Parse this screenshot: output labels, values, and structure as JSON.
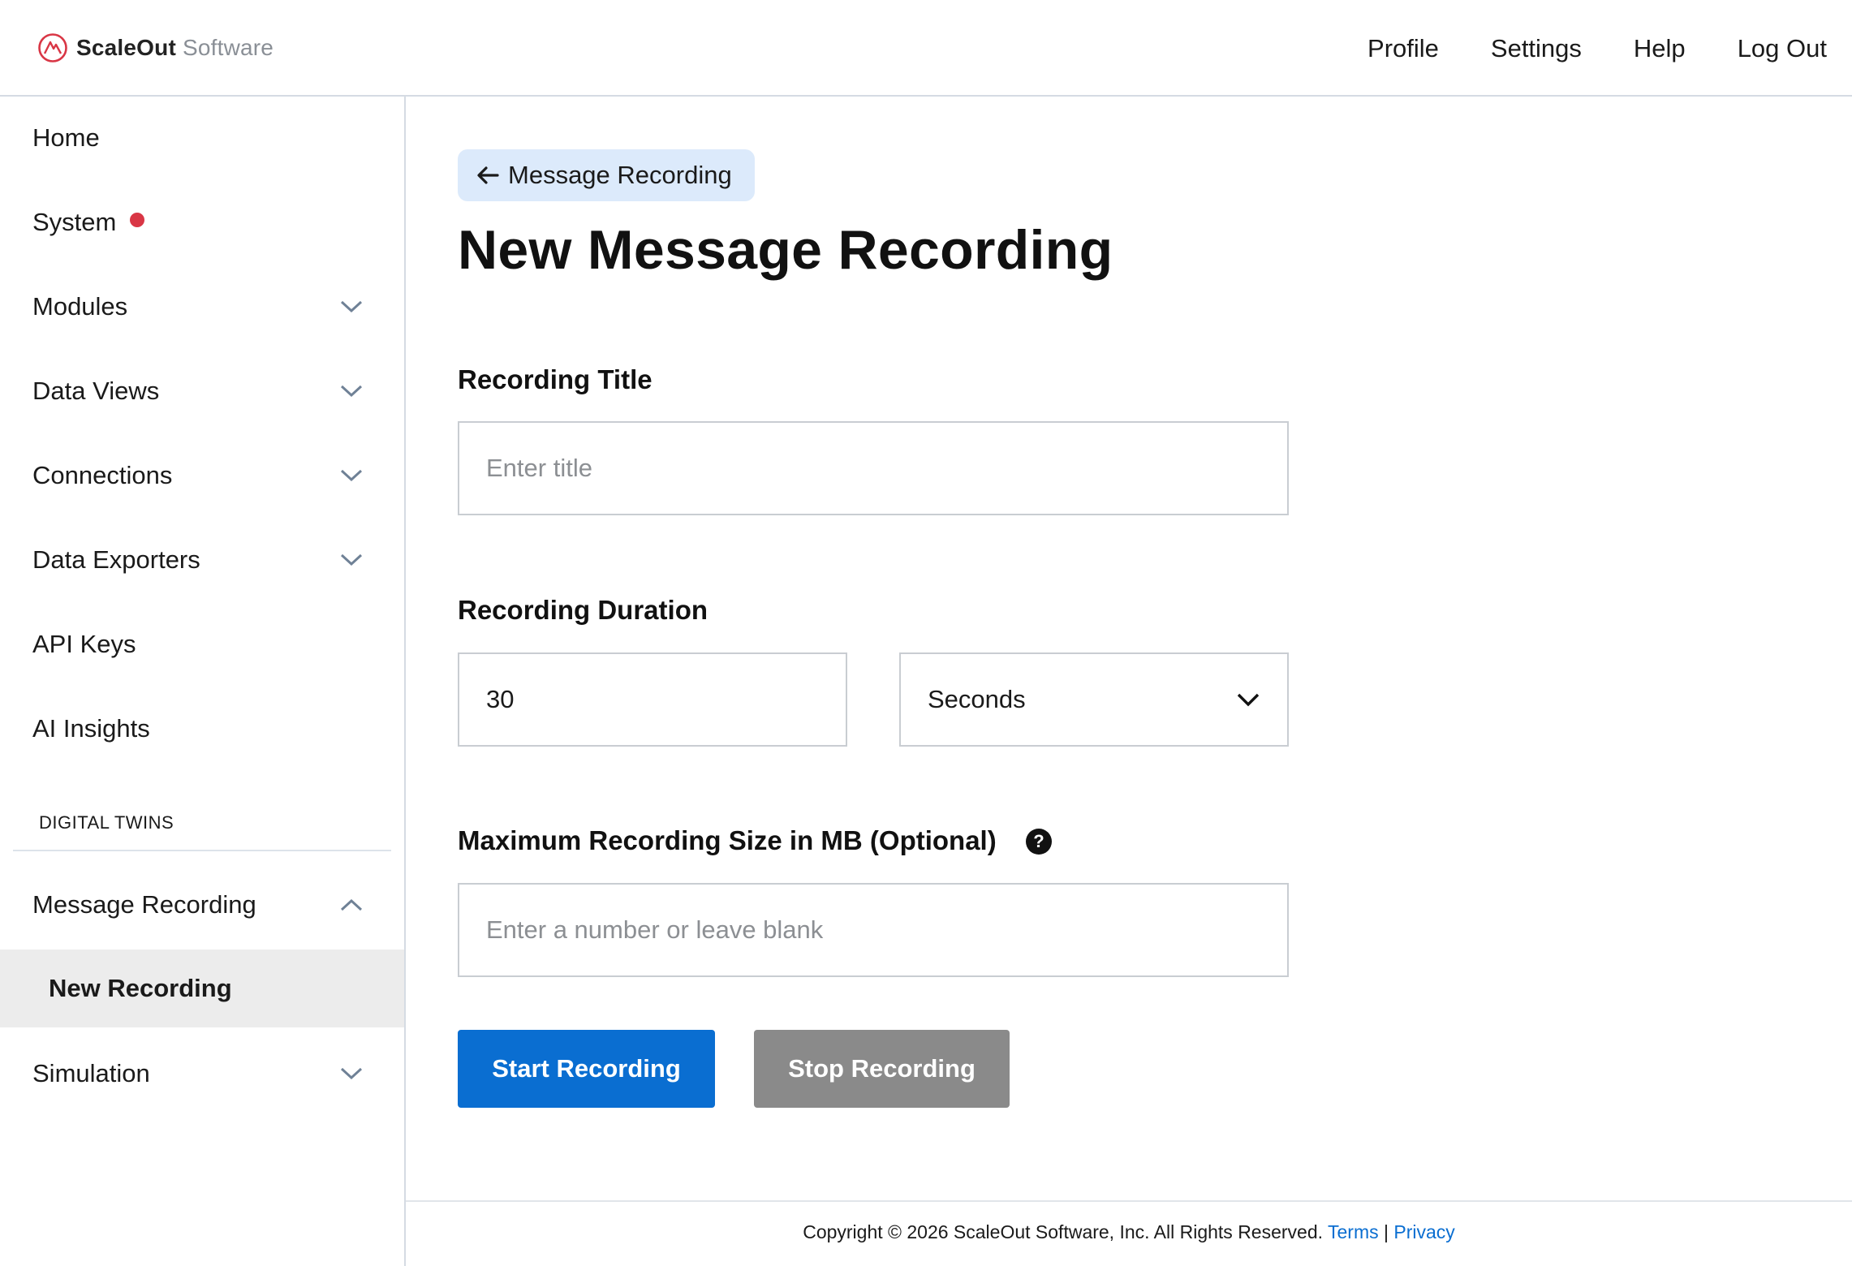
{
  "brand": {
    "name_strong": "ScaleOut",
    "name_light": "Software",
    "accent": "#d93645"
  },
  "topnav": [
    "Profile",
    "Settings",
    "Help",
    "Log Out"
  ],
  "sidebar": {
    "items": [
      {
        "label": "Home"
      },
      {
        "label": "System",
        "status_dot": true
      },
      {
        "label": "Modules",
        "icon": "chevron-down-icon"
      },
      {
        "label": "Data Views",
        "icon": "chevron-down-icon"
      },
      {
        "label": "Connections",
        "icon": "chevron-down-icon"
      },
      {
        "label": "Data Exporters",
        "icon": "chevron-down-icon"
      },
      {
        "label": "API Keys"
      },
      {
        "label": "AI Insights"
      }
    ],
    "section_label": "DIGITAL TWINS",
    "recording": {
      "label": "Message Recording",
      "icon": "chevron-up-icon",
      "sub_item": "New Recording"
    },
    "simulation": {
      "label": "Simulation",
      "icon": "chevron-down-icon"
    }
  },
  "main": {
    "back_label": "Message Recording",
    "title": "New Message Recording",
    "title_label": "Recording Title",
    "title_placeholder": "Enter title",
    "duration_label": "Recording Duration",
    "duration_value": "30",
    "duration_unit": "Seconds",
    "size_label": "Maximum Recording Size in MB (Optional)",
    "help_glyph": "?",
    "size_placeholder": "Enter a number or leave blank",
    "start_label": "Start Recording",
    "stop_label": "Stop Recording"
  },
  "footer": {
    "copyright": "Copyright © 2026 ScaleOut Software, Inc. All Rights Reserved.",
    "terms": "Terms",
    "separator": "|",
    "privacy": "Privacy"
  },
  "colors": {
    "primary": "#0a6ed1",
    "disabled": "#8a8a8a",
    "back_bg": "#dceafb",
    "selected_bg": "#ececec"
  }
}
